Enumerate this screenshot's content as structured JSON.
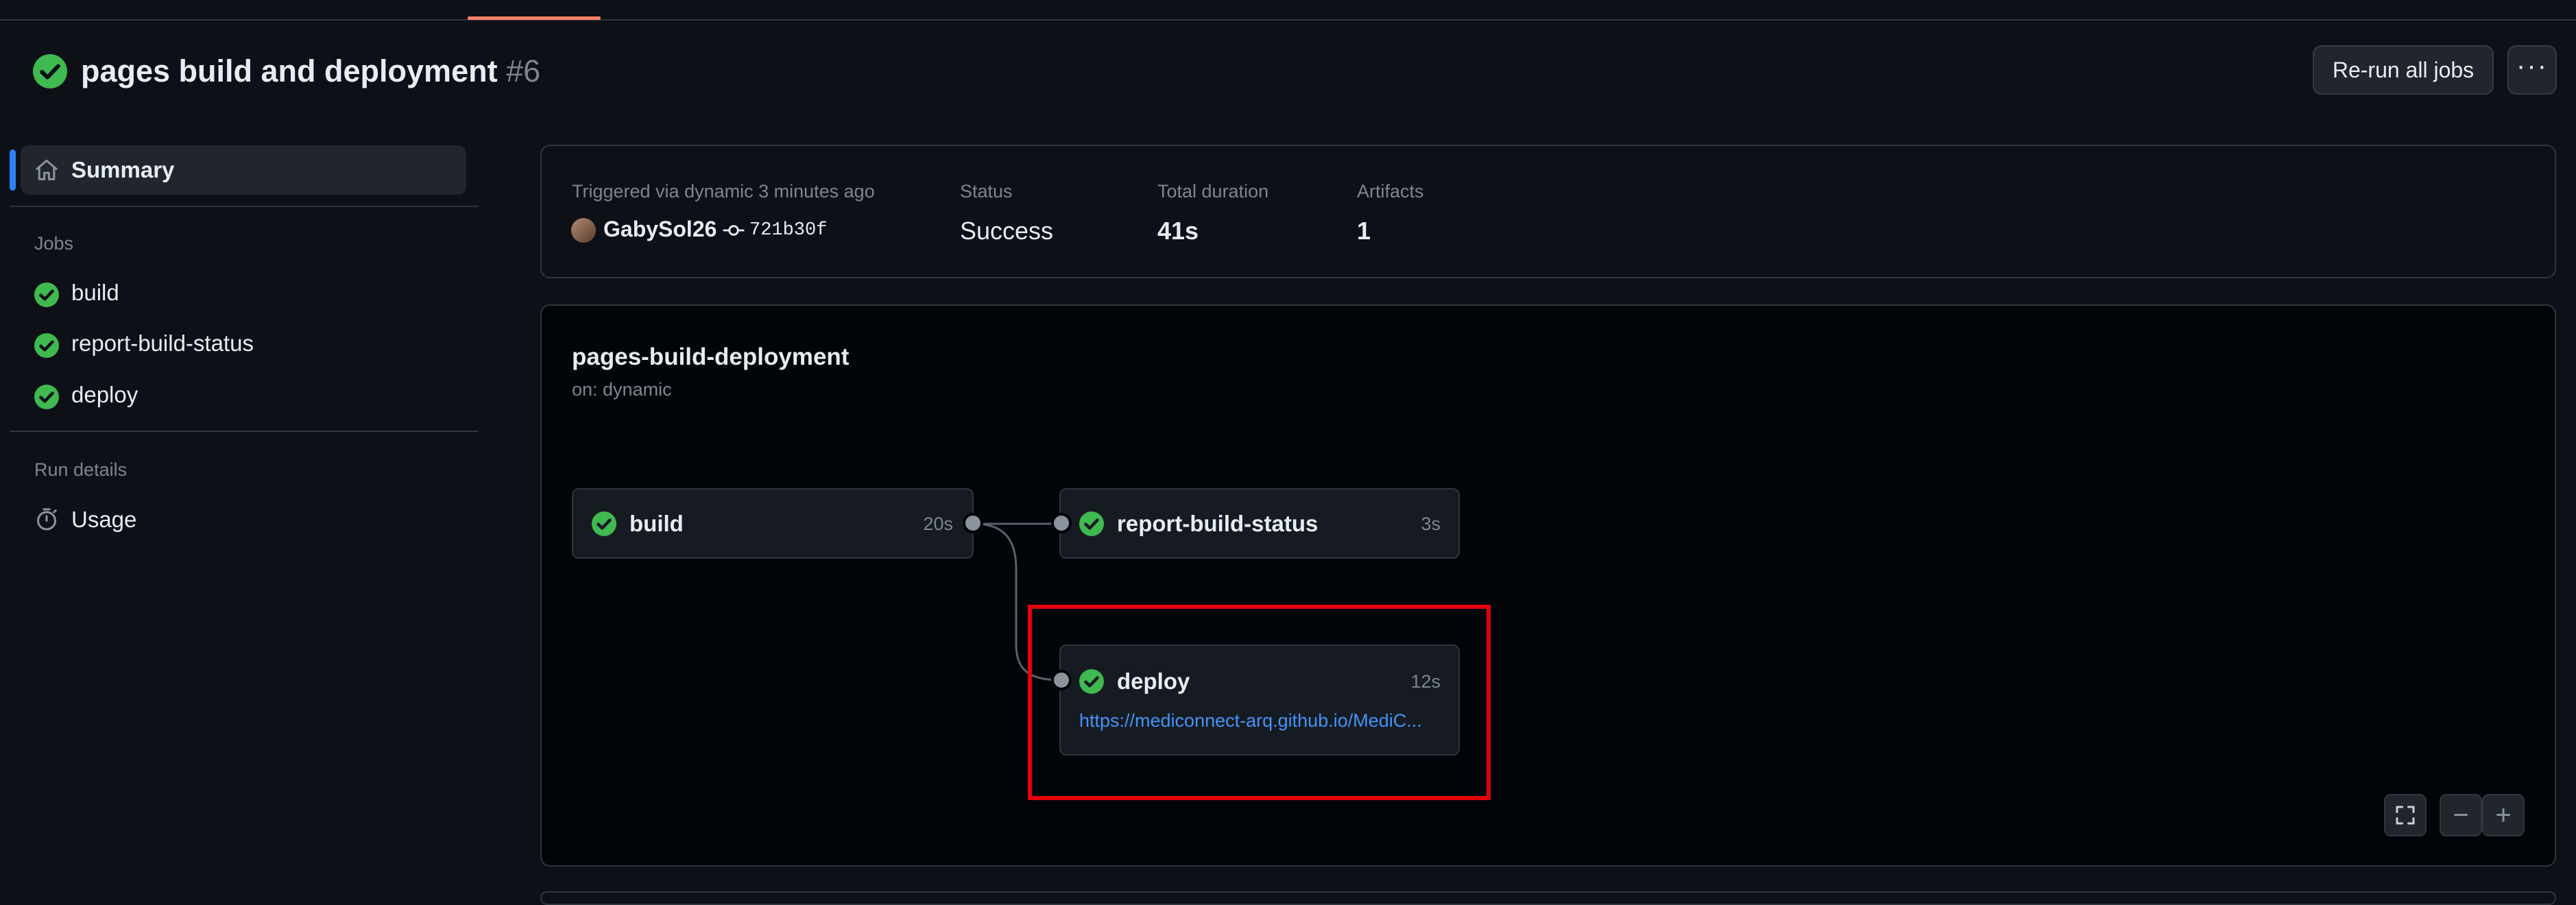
{
  "header": {
    "title": "pages build and deployment",
    "run_number": "#6",
    "rerun_label": "Re-run all jobs",
    "more_label": "···"
  },
  "sidebar": {
    "summary_label": "Summary",
    "jobs_heading": "Jobs",
    "jobs": [
      {
        "label": "build"
      },
      {
        "label": "report-build-status"
      },
      {
        "label": "deploy"
      }
    ],
    "run_details_heading": "Run details",
    "usage_label": "Usage"
  },
  "summary": {
    "triggered_label": "Triggered via dynamic 3 minutes ago",
    "user": "GabySol26",
    "commit_sha": "721b30f",
    "status_label": "Status",
    "status_value": "Success",
    "duration_label": "Total duration",
    "duration_value": "41s",
    "artifacts_label": "Artifacts",
    "artifacts_value": "1"
  },
  "workflow": {
    "name": "pages-build-deployment",
    "trigger": "on: dynamic",
    "nodes": [
      {
        "label": "build",
        "duration": "20s"
      },
      {
        "label": "report-build-status",
        "duration": "3s"
      },
      {
        "label": "deploy",
        "duration": "12s",
        "link": "https://mediconnect-arq.github.io/MediC..."
      }
    ]
  },
  "graph_controls": {
    "zoom_out_label": "−",
    "zoom_in_label": "+"
  },
  "colors": {
    "success": "#3fb950",
    "accent": "#2f81f7",
    "highlight": "#e5000a",
    "link": "#4493f8"
  }
}
